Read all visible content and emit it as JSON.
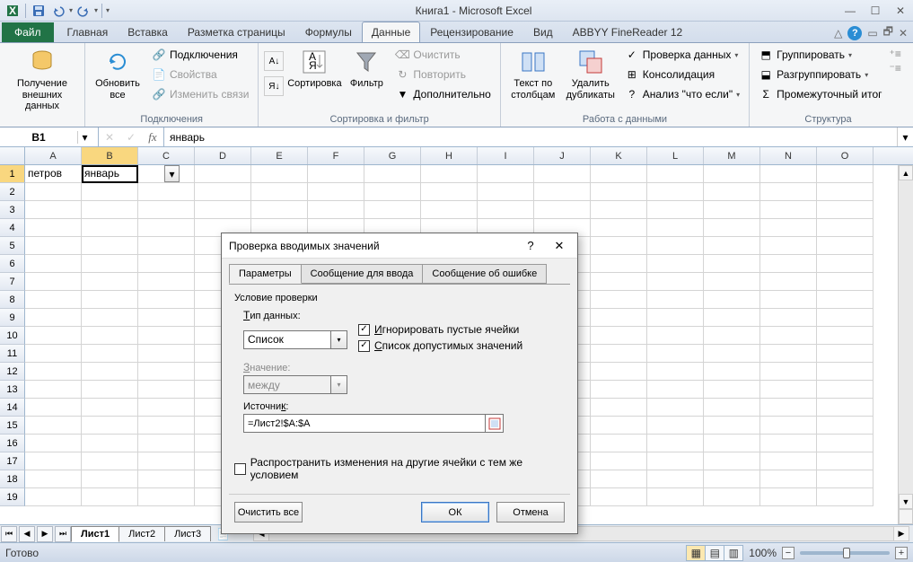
{
  "title": "Книга1  -  Microsoft Excel",
  "ribbon_tabs": {
    "file": "Файл",
    "home": "Главная",
    "insert": "Вставка",
    "page_layout": "Разметка страницы",
    "formulas": "Формулы",
    "data": "Данные",
    "review": "Рецензирование",
    "view": "Вид",
    "abbyy": "ABBYY FineReader 12"
  },
  "ribbon": {
    "get_external": "Получение\nвнешних данных",
    "refresh_all": "Обновить\nвсе",
    "connections": "Подключения",
    "properties": "Свойства",
    "edit_links": "Изменить связи",
    "group_connections": "Подключения",
    "sort": "Сортировка",
    "filter": "Фильтр",
    "clear": "Очистить",
    "reapply": "Повторить",
    "advanced": "Дополнительно",
    "group_sort_filter": "Сортировка и фильтр",
    "text_to_cols": "Текст по\nстолбцам",
    "remove_dup": "Удалить\nдубликаты",
    "data_validation": "Проверка данных",
    "consolidate": "Консолидация",
    "what_if": "Анализ \"что если\"",
    "group_data_tools": "Работа с данными",
    "group_btn": "Группировать",
    "ungroup": "Разгруппировать",
    "subtotal": "Промежуточный итог",
    "group_outline": "Структура"
  },
  "namebox": "B1",
  "formula": "январь",
  "columns": [
    "A",
    "B",
    "C",
    "D",
    "E",
    "F",
    "G",
    "H",
    "I",
    "J",
    "K",
    "L",
    "M",
    "N",
    "O"
  ],
  "rows": [
    "1",
    "2",
    "3",
    "4",
    "5",
    "6",
    "7",
    "8",
    "9",
    "10",
    "11",
    "12",
    "13",
    "14",
    "15",
    "16",
    "17",
    "18",
    "19"
  ],
  "cells": {
    "A1": "петров",
    "B1": "январь"
  },
  "sheets": [
    "Лист1",
    "Лист2",
    "Лист3"
  ],
  "status": "Готово",
  "zoom": "100%",
  "dialog": {
    "title": "Проверка вводимых значений",
    "tabs": [
      "Параметры",
      "Сообщение для ввода",
      "Сообщение об ошибке"
    ],
    "cond_label": "Условие проверки",
    "type_label": "Тип данных:",
    "type_value": "Список",
    "ignore_blank": "Игнорировать пустые ячейки",
    "dropdown_list": "Список допустимых значений",
    "value_label": "Значение:",
    "value_value": "между",
    "source_label": "Источник:",
    "source_value": "=Лист2!$A:$A",
    "propagate": "Распространить изменения на другие ячейки с тем же условием",
    "clear_all": "Очистить все",
    "ok": "ОК",
    "cancel": "Отмена"
  }
}
